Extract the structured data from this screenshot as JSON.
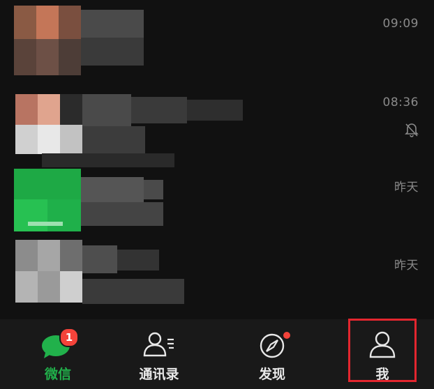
{
  "chats": [
    {
      "time": "09:09",
      "muted": false
    },
    {
      "time": "08:36",
      "muted": true
    },
    {
      "time": "昨天",
      "muted": false
    },
    {
      "time": "昨天",
      "muted": false
    }
  ],
  "tabs": [
    {
      "label": "微信",
      "icon": "chat-bubble-icon",
      "active": true,
      "badge": "1"
    },
    {
      "label": "通讯录",
      "icon": "contacts-icon",
      "active": false
    },
    {
      "label": "发现",
      "icon": "compass-icon",
      "active": false,
      "dot": true
    },
    {
      "label": "我",
      "icon": "person-icon",
      "active": false
    }
  ],
  "colors": {
    "accent_green": "#21b14b",
    "badge_red": "#f4433a",
    "highlight_red": "#e3262f",
    "background": "#111111",
    "tab_bar": "#191919"
  },
  "annotation": {
    "highlighted_tab": "我"
  }
}
